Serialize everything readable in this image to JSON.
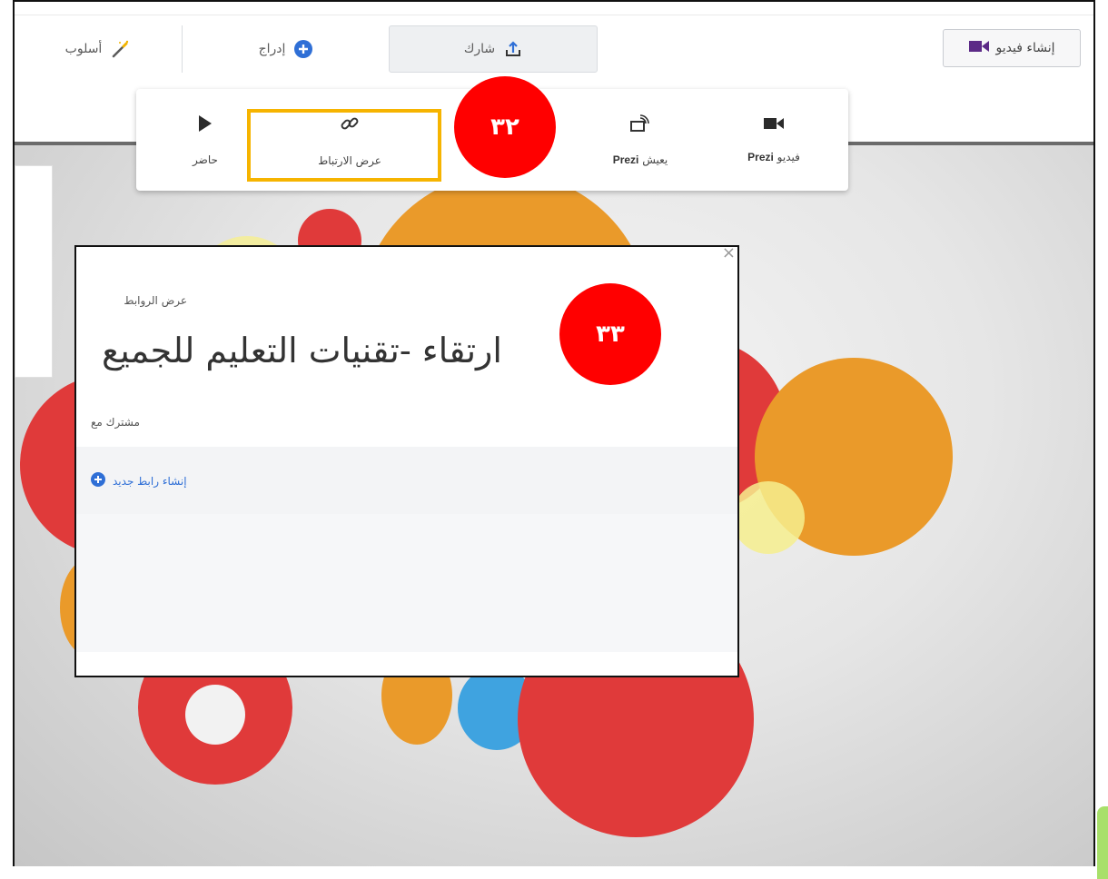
{
  "toolbar": {
    "tabs": [
      {
        "label": "أسلوب",
        "icon": "magic-wand-icon"
      },
      {
        "label": "إدراج",
        "icon": "plus-circle-icon"
      },
      {
        "label": "شارك",
        "icon": "share-upload-icon"
      }
    ],
    "create_video_label": "إنشاء فيديو",
    "create_video_icon": "video-camera-icon"
  },
  "share_menu": {
    "items": [
      {
        "label": "حاضر",
        "icon": "play-icon"
      },
      {
        "label": "عرض الارتباط",
        "icon": "link-icon"
      },
      {
        "label": "Prezi",
        "suffix": "يعيش",
        "icon": "broadcast-icon"
      },
      {
        "label": "Prezi",
        "suffix": "فيديو",
        "icon": "video-camera-icon"
      }
    ]
  },
  "annotations": {
    "badge_32": "٣٢",
    "badge_33": "٣٣"
  },
  "dialog": {
    "section_title": "عرض الروابط",
    "presentation_name": "ارتقاء -تقنيات التعليم للجميع",
    "shared_with": "مشترك مع",
    "new_link": "إنشاء رابط جديد",
    "close": "×"
  },
  "colors": {
    "accent_blue": "#2f6fd6",
    "highlight": "#f6b400",
    "badge_red": "#ff0000",
    "video_purple": "#5c2a87"
  }
}
